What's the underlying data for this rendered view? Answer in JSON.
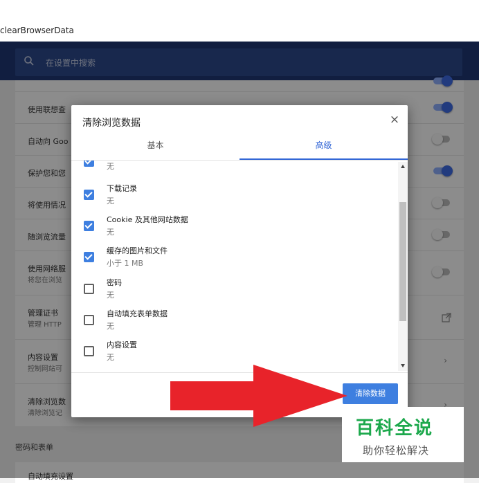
{
  "browser": {
    "url_fragment": "clearBrowserData"
  },
  "settings": {
    "search_placeholder": "在设置中搜索",
    "rows": [
      {
        "title": "使用联想查",
        "sub": "",
        "toggle": "on"
      },
      {
        "title": "自动向 Goo",
        "sub": "",
        "toggle": "off"
      },
      {
        "title": "保护您和您",
        "sub": "",
        "toggle": "on"
      },
      {
        "title": "将使用情况",
        "sub": "",
        "toggle": "off"
      },
      {
        "title": "随浏览流量",
        "sub": "",
        "toggle": "off"
      },
      {
        "title": "使用网络服",
        "sub": "将您在浏览",
        "toggle": "off"
      },
      {
        "title": "管理证书",
        "sub": "管理 HTTP",
        "toggle": "link"
      },
      {
        "title": "内容设置",
        "sub": "控制网站可",
        "toggle": "chevron"
      },
      {
        "title": "清除浏览数",
        "sub": "清除浏览记",
        "toggle": "chevron"
      }
    ],
    "section_label": "密码和表单",
    "next_row": "自动填充设置"
  },
  "dialog": {
    "title": "清除浏览数据",
    "close": "×",
    "tabs": {
      "basic": "基本",
      "advanced": "高级"
    },
    "items": [
      {
        "title": "",
        "sub": "无",
        "checked": true
      },
      {
        "title": "下载记录",
        "sub": "无",
        "checked": true
      },
      {
        "title": "Cookie 及其他网站数据",
        "sub": "无",
        "checked": true
      },
      {
        "title": "缓存的图片和文件",
        "sub": "小于 1 MB",
        "checked": true
      },
      {
        "title": "密码",
        "sub": "无",
        "checked": false
      },
      {
        "title": "自动填充表单数据",
        "sub": "无",
        "checked": false
      },
      {
        "title": "内容设置",
        "sub": "无",
        "checked": false
      }
    ],
    "clear_button": "清除数据"
  },
  "watermark": {
    "line1": "百科全说",
    "line2": "助你轻松解决"
  },
  "colors": {
    "header": "#1f3876",
    "accent": "#3e7fe0",
    "arrow": "#e8232a",
    "watermark": "#1ca84c"
  }
}
